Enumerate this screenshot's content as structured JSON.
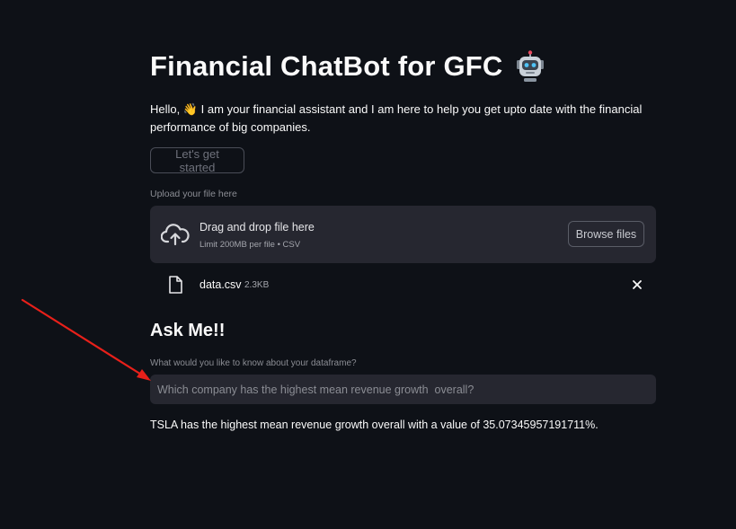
{
  "header": {
    "title": "Financial ChatBot for GFC",
    "title_emoji": "robot-icon"
  },
  "intro": {
    "greeting": "Hello,",
    "wave_emoji": "👋",
    "text": " I am your financial assistant and I am here to help you get upto date with the financial performance of big companies."
  },
  "start_button": {
    "label": "Let's get started"
  },
  "uploader": {
    "label": "Upload your file here",
    "drag_text": "Drag and drop file here",
    "limit_text": "Limit 200MB per file • CSV",
    "browse_label": "Browse files",
    "icon": "cloud-upload-icon"
  },
  "uploaded_file": {
    "name": "data.csv",
    "size": "2.3KB",
    "icon": "file-icon",
    "remove_icon": "close-icon"
  },
  "ask": {
    "heading": "Ask Me!!",
    "input_label": "What would you like to know about your dataframe?",
    "input_value": "Which company has the highest mean revenue growth  overall?"
  },
  "answer": {
    "text": "TSLA has the highest mean revenue growth overall with a value of 35.07345957191711%."
  },
  "annotation": {
    "arrow_color": "#e8201a"
  },
  "colors": {
    "background": "#0e1117",
    "panel": "#262730",
    "text": "#fafafa",
    "muted": "#8b8d94"
  }
}
